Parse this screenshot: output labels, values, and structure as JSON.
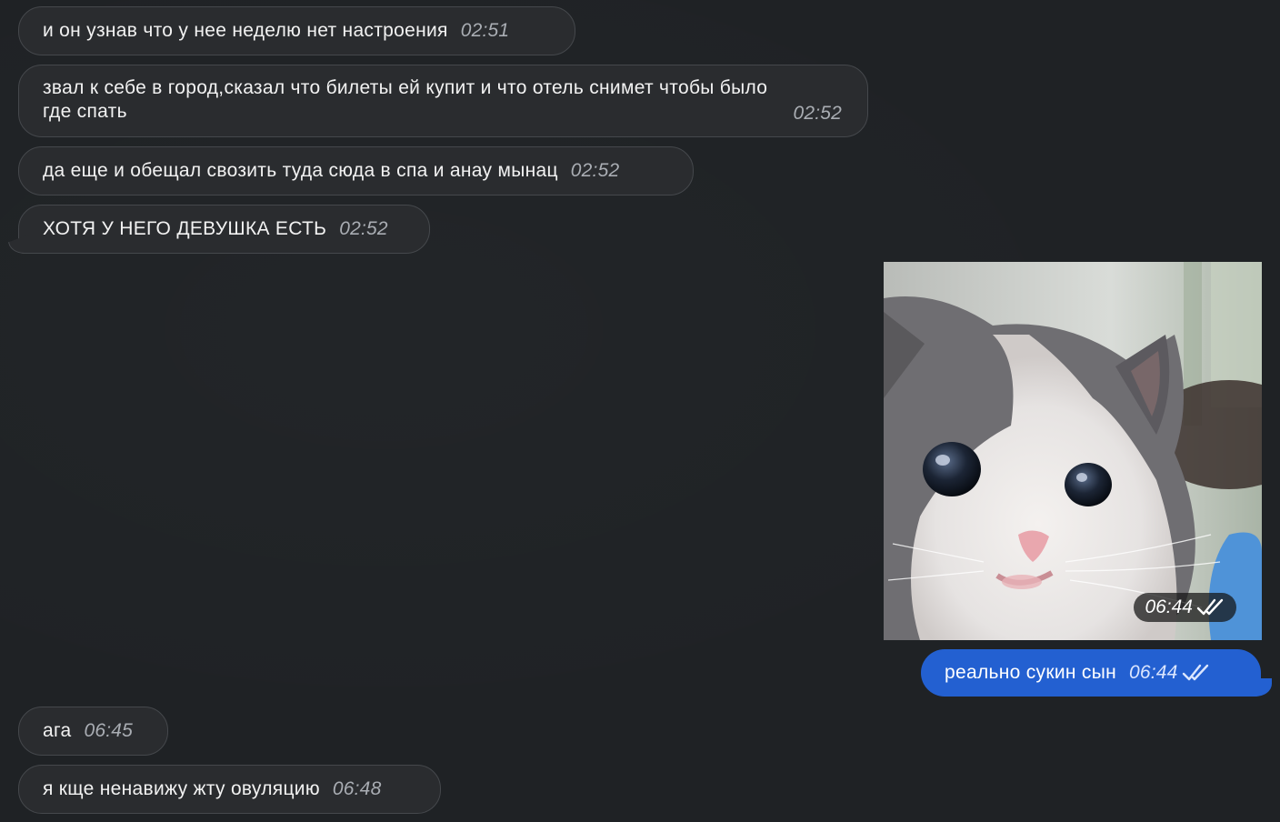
{
  "messages": [
    {
      "text": "и он узнав что у нее неделю нет настроения",
      "time": "02:51"
    },
    {
      "text_line1": "звал к себе в город,сказал что билеты ей купит и что отель снимет чтобы было",
      "text_line2": "где спать",
      "time": "02:52"
    },
    {
      "text": "да еще и обещал свозить туда сюда в спа и анау мынац",
      "time": "02:52"
    },
    {
      "text": "ХОТЯ У НЕГО ДЕВУШКА ЕСТЬ",
      "time": "02:52"
    },
    {
      "photo_icon": "kitten-photo",
      "time": "06:44",
      "status_icon": "double-check-icon"
    },
    {
      "text": "реально сукин сын",
      "time": "06:44",
      "status_icon": "double-check-icon"
    },
    {
      "text": "ага",
      "time": "06:45"
    },
    {
      "text": "я кще ненавижу жту овуляцию",
      "time": "06:48"
    }
  ],
  "colors": {
    "background": "#1f2225",
    "incoming_bubble": "#2a2c2f",
    "outgoing_bubble": "#2360d1"
  }
}
